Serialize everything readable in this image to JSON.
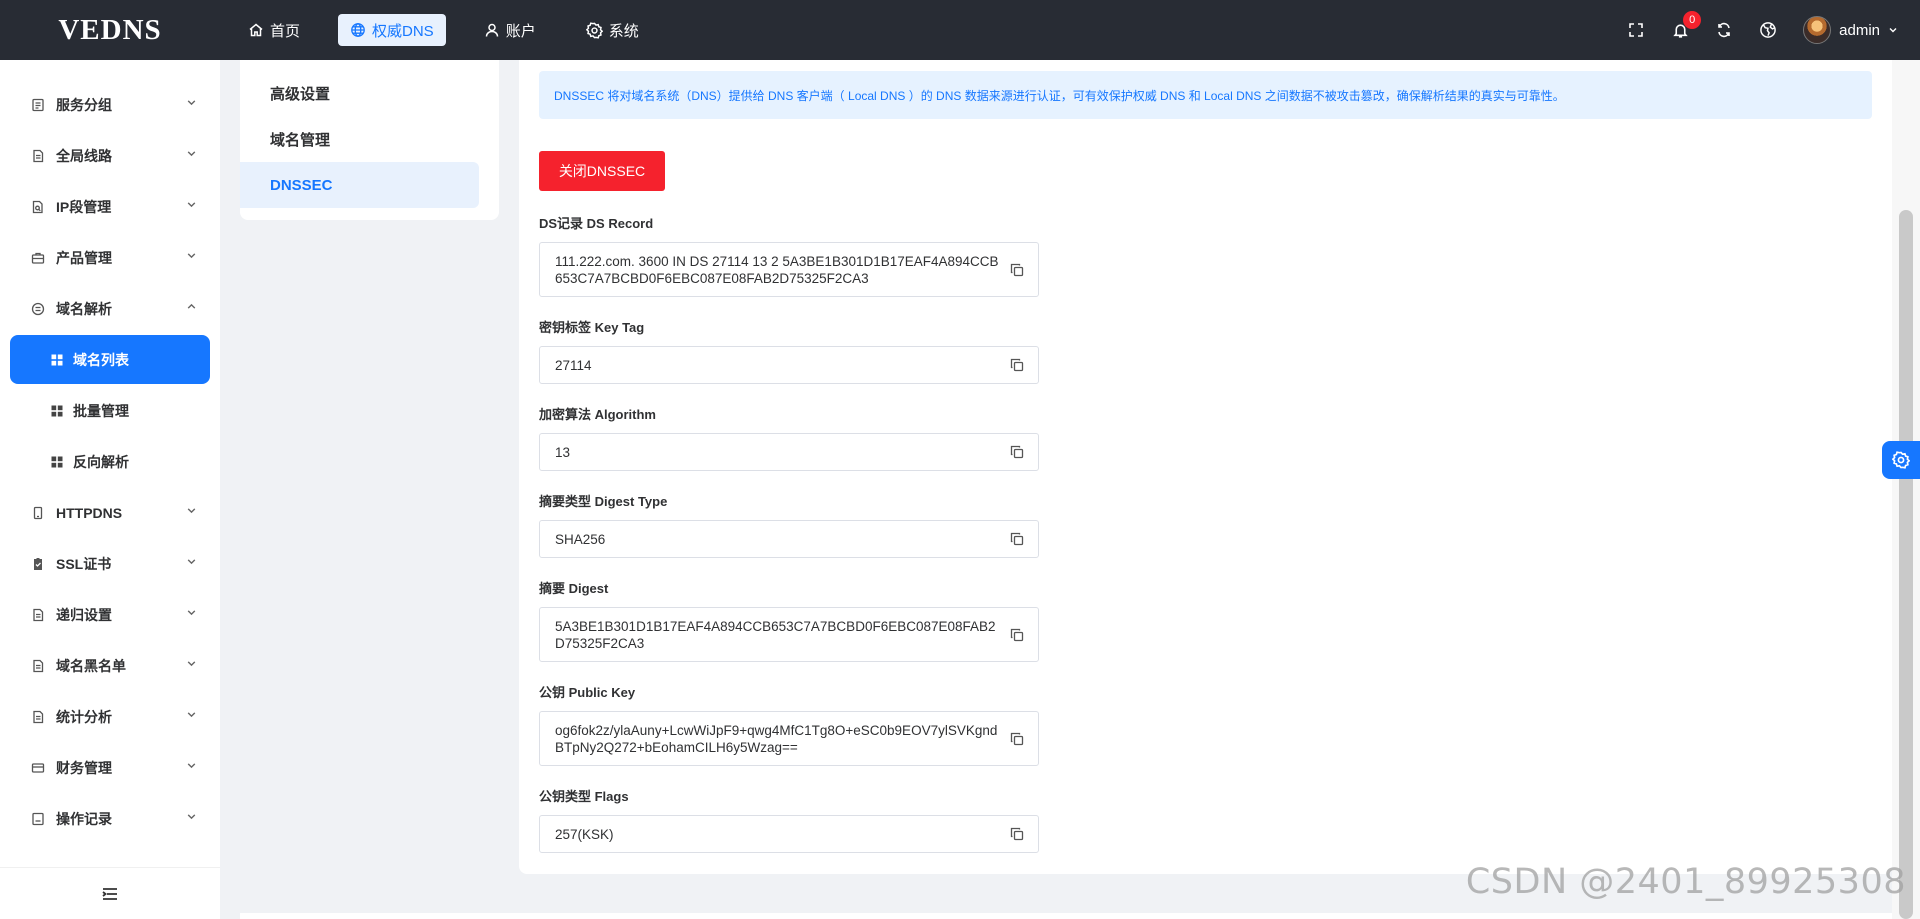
{
  "brand": "VEDNS",
  "topnav": [
    {
      "label": "首页",
      "icon": "home-icon"
    },
    {
      "label": "权威DNS",
      "icon": "globe-icon",
      "active": true
    },
    {
      "label": "账户",
      "icon": "user-icon"
    },
    {
      "label": "系统",
      "icon": "gear-icon"
    }
  ],
  "header": {
    "notification_count": "0",
    "username": "admin"
  },
  "sidebar": {
    "items": [
      {
        "label": "服务分组"
      },
      {
        "label": "全局线路"
      },
      {
        "label": "IP段管理"
      },
      {
        "label": "产品管理"
      },
      {
        "label": "域名解析",
        "expanded": true,
        "children": [
          {
            "label": "域名列表",
            "active": true
          },
          {
            "label": "批量管理"
          },
          {
            "label": "反向解析"
          }
        ]
      },
      {
        "label": "HTTPDNS"
      },
      {
        "label": "SSL证书"
      },
      {
        "label": "递归设置"
      },
      {
        "label": "域名黑名单"
      },
      {
        "label": "统计分析"
      },
      {
        "label": "财务管理"
      },
      {
        "label": "操作记录"
      }
    ]
  },
  "submenu": {
    "items": [
      "高级设置",
      "域名管理",
      "DNSSEC"
    ],
    "active": "DNSSEC"
  },
  "dnssec": {
    "info": "DNSSEC 将对域名系统（DNS）提供给 DNS 客户端（ Local DNS ）的 DNS 数据来源进行认证，可有效保护权威 DNS 和 Local DNS 之间数据不被攻击篡改，确保解析结果的真实与可靠性。",
    "toggle_label": "关闭DNSSEC",
    "fields": [
      {
        "label": "DS记录 DS Record",
        "value": "111.222.com. 3600 IN DS 27114 13 2 5A3BE1B301D1B17EAF4A894CCB653C7A7BCBD0F6EBC087E08FAB2D75325F2CA3",
        "lines": 2
      },
      {
        "label": "密钥标签 Key Tag",
        "value": "27114",
        "lines": 1
      },
      {
        "label": "加密算法 Algorithm",
        "value": "13",
        "lines": 1
      },
      {
        "label": "摘要类型 Digest Type",
        "value": "SHA256",
        "lines": 1
      },
      {
        "label": "摘要 Digest",
        "value": "5A3BE1B301D1B17EAF4A894CCB653C7A7BCBD0F6EBC087E08FAB2D75325F2CA3",
        "lines": 2
      },
      {
        "label": "公钥 Public Key",
        "value": "og6fok2z/ylaAuny+LcwWiJpF9+qwg4MfC1Tg8O+eSC0b9EOV7ylSVKgndBTpNy2Q272+bEohamCILH6y5Wzag==",
        "lines": 2
      },
      {
        "label": "公钥类型 Flags",
        "value": "257(KSK)",
        "lines": 1
      }
    ]
  },
  "watermark": "CSDN @2401_89925308",
  "colors": {
    "primary": "#1677ff",
    "danger": "#f5222d",
    "topbar": "#282c34",
    "page_bg": "#f0f2f5"
  }
}
